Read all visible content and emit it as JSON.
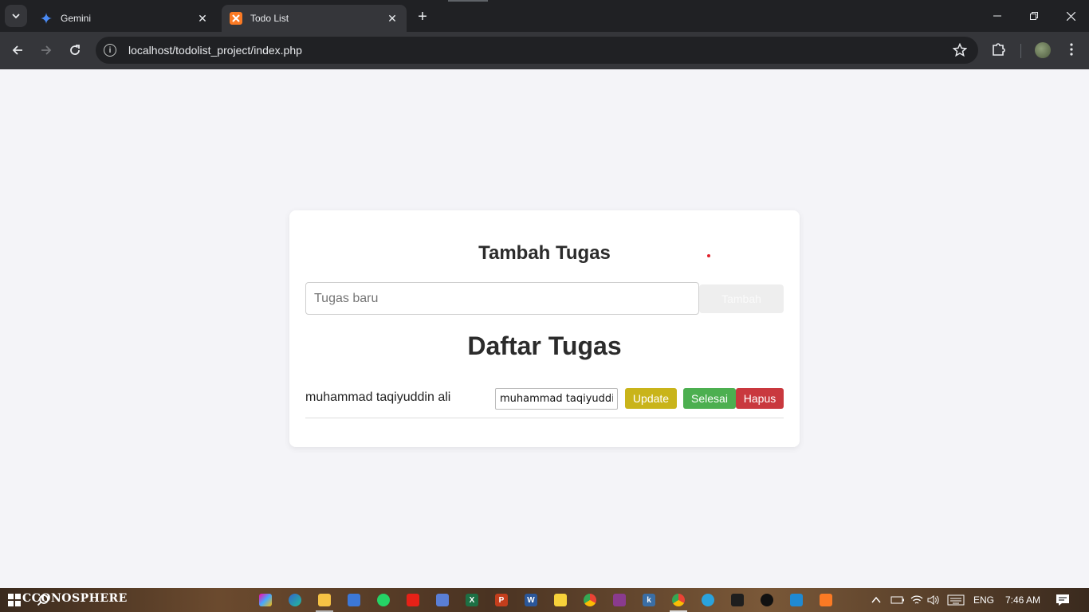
{
  "browser": {
    "tabs": [
      {
        "title": "Gemini",
        "favicon": "gemini-sparkle-icon"
      },
      {
        "title": "Todo List",
        "favicon": "xampp-icon"
      }
    ],
    "url": "localhost/todolist_project/index.php"
  },
  "page": {
    "add_heading": "Tambah Tugas",
    "new_task_placeholder": "Tugas baru",
    "add_button": "Tambah",
    "list_heading": "Daftar Tugas",
    "tasks": [
      {
        "text": "muhammad taqiyuddin ali",
        "edit_value": "muhammad taqiyuddin ali",
        "update_label": "Update",
        "done_label": "Selesai",
        "delete_label": "Hapus"
      }
    ],
    "colors": {
      "update": "#c9b41a",
      "done": "#4caf50",
      "delete": "#c9383e"
    }
  },
  "taskbar": {
    "wallpaper_text": "CCONOSPHERE",
    "language": "ENG",
    "time": "7:46 AM"
  }
}
